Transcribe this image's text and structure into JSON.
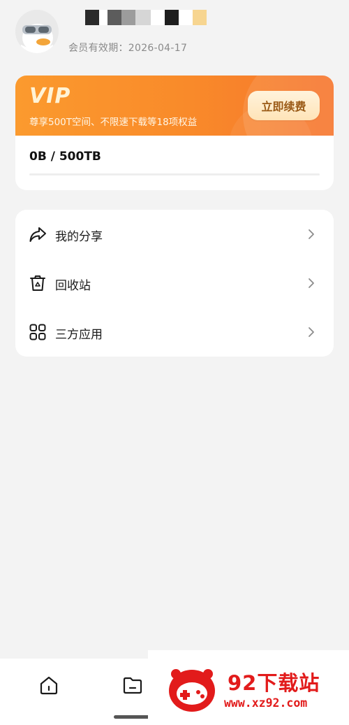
{
  "header": {
    "membership_label": "会员有效期：2026-04-17"
  },
  "vip": {
    "title": "VIP",
    "description": "尊享500T空间、不限速下载等18项权益",
    "renew_label": "立即续费",
    "storage_text": "0B / 500TB",
    "storage_used_fraction": 0
  },
  "menu": {
    "items": [
      {
        "label": "我的分享",
        "icon": "share-icon"
      },
      {
        "label": "回收站",
        "icon": "trash-icon"
      },
      {
        "label": "三方应用",
        "icon": "apps-grid-icon"
      }
    ]
  },
  "bottom_nav": {
    "items": [
      {
        "icon": "home-icon"
      },
      {
        "icon": "folder-icon"
      }
    ]
  },
  "watermark": {
    "name": "92下载站",
    "url": "www.xz92.com"
  },
  "colors": {
    "accent_orange": "#f98a2a",
    "renew_text": "#9a5a16",
    "watermark_red": "#e21b1b"
  }
}
